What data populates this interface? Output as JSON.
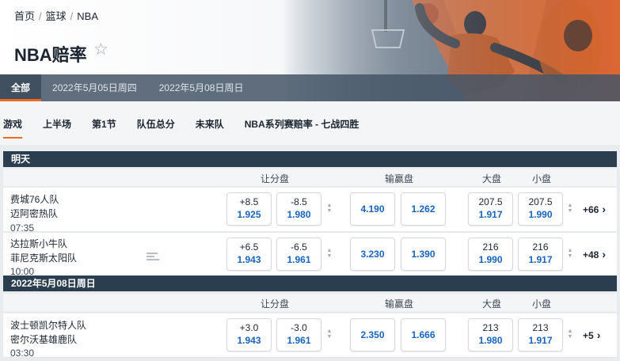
{
  "breadcrumb": {
    "home": "首页",
    "sport": "篮球",
    "league": "NBA"
  },
  "title": "NBA赔率",
  "date_tabs": [
    "全部",
    "2022年5月05日周四",
    "2022年5月08日周日"
  ],
  "market_tabs": [
    "游戏",
    "上半场",
    "第1节",
    "队伍总分",
    "未来队",
    "NBA系列赛赔率 - 七战四胜"
  ],
  "accent_color": "#f06a1d",
  "sections": [
    {
      "label": "明天",
      "headers": {
        "spread": "让分盘",
        "moneyline": "输赢盘",
        "over": "大盘",
        "under": "小盘"
      },
      "events": [
        {
          "home": "费城76人队",
          "away": "迈阿密热队",
          "time": "07:35",
          "spread": [
            {
              "line": "+8.5",
              "price": "1.925"
            },
            {
              "line": "-8.5",
              "price": "1.980"
            }
          ],
          "moneyline": [
            "4.190",
            "1.262"
          ],
          "total": [
            {
              "line": "207.5",
              "price": "1.917"
            },
            {
              "line": "207.5",
              "price": "1.990"
            }
          ],
          "more": "+66"
        },
        {
          "home": "达拉斯小牛队",
          "away": "菲尼克斯太阳队",
          "time": "10:00",
          "spread": [
            {
              "line": "+6.5",
              "price": "1.943"
            },
            {
              "line": "-6.5",
              "price": "1.961"
            }
          ],
          "moneyline": [
            "3.230",
            "1.390"
          ],
          "total": [
            {
              "line": "216",
              "price": "1.990"
            },
            {
              "line": "216",
              "price": "1.917"
            }
          ],
          "more": "+48"
        }
      ]
    },
    {
      "label": "2022年5月08日周日",
      "headers": {
        "spread": "让分盘",
        "moneyline": "输赢盘",
        "over": "大盘",
        "under": "小盘"
      },
      "events": [
        {
          "home": "波士顿凯尔特人队",
          "away": "密尔沃基雄鹿队",
          "time": "03:30",
          "spread": [
            {
              "line": "+3.0",
              "price": "1.943"
            },
            {
              "line": "-3.0",
              "price": "1.961"
            }
          ],
          "moneyline": [
            "2.350",
            "1.666"
          ],
          "total": [
            {
              "line": "213",
              "price": "1.980"
            },
            {
              "line": "213",
              "price": "1.917"
            }
          ],
          "more": "+5"
        }
      ]
    }
  ]
}
